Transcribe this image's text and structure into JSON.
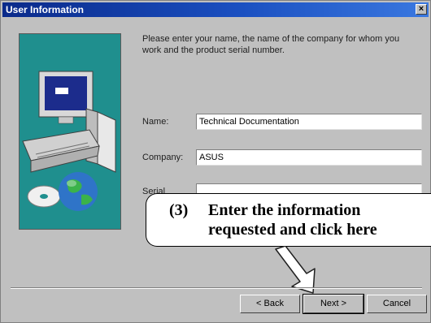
{
  "window": {
    "title": "User Information",
    "close_label": "×"
  },
  "prompt": "Please enter your name, the name of the company for whom you work and the product serial number.",
  "form": {
    "name_label": "Name:",
    "name_value": "Technical Documentation",
    "company_label": "Company:",
    "company_value": "ASUS",
    "serial_label": "Serial",
    "serial_value": ""
  },
  "buttons": {
    "back_label": "< Back",
    "next_label": "Next >",
    "cancel_label": "Cancel"
  },
  "callout": {
    "number": "(3)",
    "line1": "Enter the information",
    "line2": "requested and click here"
  },
  "colors": {
    "titlebar": "#1a4fc0",
    "art_background": "#1f8f8e",
    "dialog": "#c0c0c0"
  },
  "icons": [
    "computer-illustration",
    "cd-disc-icon",
    "globe-icon",
    "close-icon",
    "arrow-pointer-icon"
  ]
}
